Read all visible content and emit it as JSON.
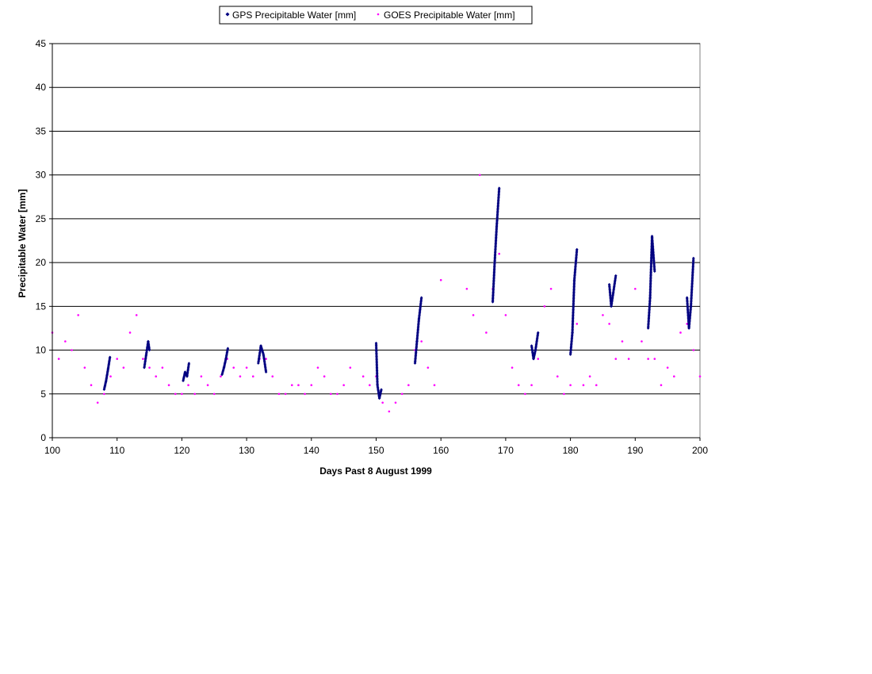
{
  "chart_data": {
    "type": "scatter",
    "title": "",
    "xlabel": "Days Past 8 August 1999",
    "ylabel": "Precipitable Water [mm]",
    "xlim": [
      100,
      200
    ],
    "ylim": [
      0,
      45
    ],
    "xticks": [
      100,
      110,
      120,
      130,
      140,
      150,
      160,
      170,
      180,
      190,
      200
    ],
    "yticks": [
      0,
      5,
      10,
      15,
      20,
      25,
      30,
      35,
      40,
      45
    ],
    "grid": "horizontal",
    "legend_position": "top",
    "series": [
      {
        "name": "GPS Precipitable Water [mm]",
        "color": "#000080",
        "marker": "diamond",
        "segments": [
          {
            "x": [
              108.0,
              108.3,
              108.6,
              108.9
            ],
            "y": [
              5.5,
              6.5,
              7.8,
              9.2
            ]
          },
          {
            "x": [
              114.2,
              114.5,
              114.8,
              115.0
            ],
            "y": [
              8.0,
              9.5,
              11.0,
              10.0
            ]
          },
          {
            "x": [
              120.2,
              120.5,
              120.8,
              121.1
            ],
            "y": [
              6.5,
              7.5,
              7.0,
              8.5
            ]
          },
          {
            "x": [
              126.2,
              126.5,
              126.8,
              127.1
            ],
            "y": [
              7.2,
              8.0,
              9.0,
              10.2
            ]
          },
          {
            "x": [
              131.8,
              132.2,
              132.6,
              133.0
            ],
            "y": [
              8.5,
              10.5,
              9.5,
              7.5
            ]
          },
          {
            "x": [
              150.0,
              150.2,
              150.5,
              150.8
            ],
            "y": [
              10.8,
              6.0,
              4.5,
              5.5
            ]
          },
          {
            "x": [
              156.0,
              156.3,
              156.6,
              157.0
            ],
            "y": [
              8.5,
              11.0,
              13.5,
              16.0
            ]
          },
          {
            "x": [
              168.0,
              168.3,
              168.6,
              169.0
            ],
            "y": [
              15.5,
              20.0,
              24.0,
              28.5
            ]
          },
          {
            "x": [
              174.0,
              174.3,
              174.6,
              175.0
            ],
            "y": [
              10.5,
              9.0,
              10.0,
              12.0
            ]
          },
          {
            "x": [
              180.0,
              180.3,
              180.6,
              181.0
            ],
            "y": [
              9.5,
              12.0,
              18.0,
              21.5
            ]
          },
          {
            "x": [
              186.0,
              186.3,
              186.6,
              187.0
            ],
            "y": [
              17.5,
              15.0,
              16.5,
              18.5
            ]
          },
          {
            "x": [
              192.0,
              192.3,
              192.6,
              193.0
            ],
            "y": [
              12.5,
              16.0,
              23.0,
              19.0
            ]
          },
          {
            "x": [
              198.0,
              198.3,
              198.6,
              199.0
            ],
            "y": [
              16.0,
              12.5,
              15.0,
              20.5
            ]
          }
        ]
      },
      {
        "name": "GOES Precipitable Water [mm]",
        "color": "#FF00FF",
        "marker": "point",
        "x": [
          100,
          101,
          102,
          103,
          104,
          105,
          106,
          107,
          108,
          109,
          110,
          111,
          112,
          113,
          114,
          115,
          116,
          117,
          118,
          119,
          120,
          121,
          122,
          123,
          124,
          125,
          126,
          127,
          128,
          129,
          130,
          131,
          132,
          133,
          134,
          135,
          136,
          137,
          138,
          139,
          140,
          141,
          142,
          143,
          144,
          145,
          146,
          148,
          149,
          150,
          151,
          152,
          153,
          154,
          155,
          156,
          157,
          158,
          159,
          160,
          164,
          165,
          166,
          167,
          168,
          169,
          170,
          171,
          172,
          173,
          174,
          175,
          176,
          177,
          178,
          179,
          180,
          181,
          182,
          183,
          184,
          185,
          186,
          187,
          188,
          189,
          190,
          191,
          192,
          193,
          194,
          195,
          196,
          197,
          198,
          199,
          200
        ],
        "y": [
          12,
          9,
          11,
          10,
          14,
          8,
          6,
          4,
          5,
          7,
          9,
          8,
          12,
          14,
          9,
          8,
          7,
          8,
          6,
          5,
          5,
          6,
          5,
          7,
          6,
          5,
          7,
          9,
          8,
          7,
          8,
          7,
          9,
          9,
          7,
          5,
          5,
          6,
          6,
          5,
          6,
          8,
          7,
          5,
          5,
          6,
          8,
          7,
          6,
          7,
          4,
          3,
          4,
          5,
          6,
          10,
          11,
          8,
          6,
          18,
          17,
          14,
          30,
          12,
          17,
          21,
          14,
          8,
          6,
          5,
          6,
          9,
          15,
          17,
          7,
          5,
          6,
          13,
          6,
          7,
          6,
          14,
          13,
          9,
          11,
          9,
          17,
          11,
          9,
          9,
          6,
          8,
          7,
          12,
          13,
          10,
          7
        ]
      }
    ]
  }
}
